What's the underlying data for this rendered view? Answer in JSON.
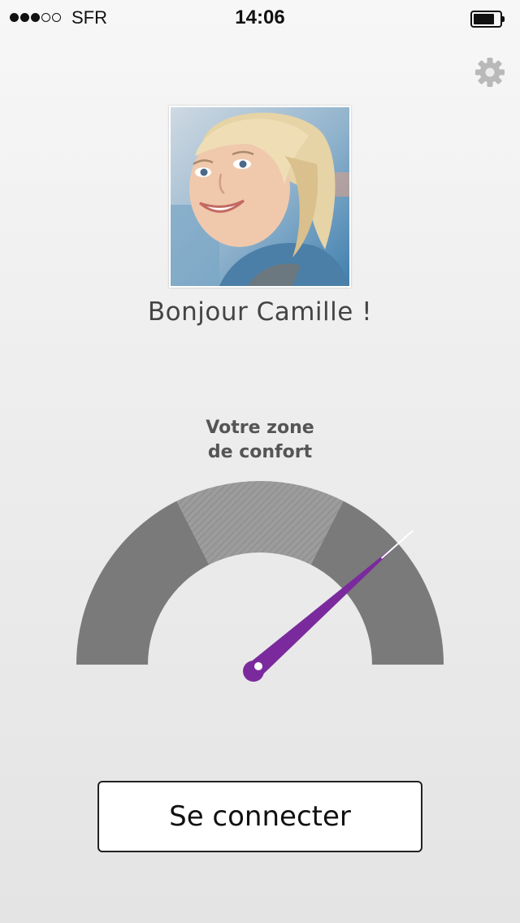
{
  "status_bar": {
    "carrier": "SFR",
    "time": "14:06",
    "signal_bars_filled": 3,
    "signal_bars_total": 5,
    "battery_level": 0.8
  },
  "header": {
    "settings_icon": "gear-icon"
  },
  "profile": {
    "greeting": "Bonjour Camille !"
  },
  "comfort_gauge": {
    "caption_line1": "Votre zone",
    "caption_line2": "de confort",
    "comfort_zone_start": 0.35,
    "comfort_zone_end": 0.65,
    "needle_value": 0.77,
    "needle_color": "#7b2a9e",
    "arc_color": "#7a7a7a",
    "zone_color": "#9c9c9c"
  },
  "actions": {
    "connect_label": "Se connecter"
  }
}
